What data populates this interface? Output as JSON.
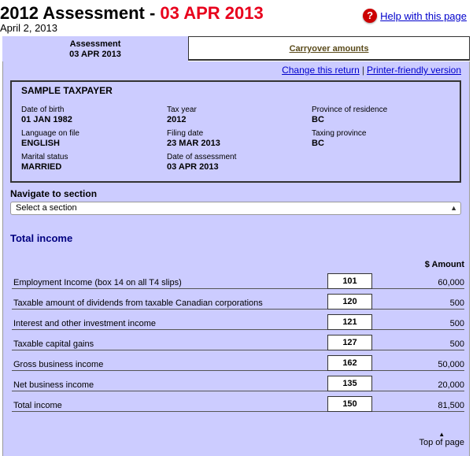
{
  "header": {
    "title_prefix": "2012 Assessment - ",
    "title_date": "03 APR 2013",
    "date": "April 2, 2013",
    "help_icon": "question-icon",
    "help_label": "Help with this page"
  },
  "tabs": {
    "active_line1": "Assessment",
    "active_line2": "03 APR 2013",
    "other": "Carryover amounts"
  },
  "links": {
    "change": "Change this return",
    "separator": "|",
    "printer": "Printer-friendly version"
  },
  "taxpayer": {
    "name": "SAMPLE TAXPAYER",
    "fields": [
      {
        "label": "Date of birth",
        "value": "01 JAN 1982"
      },
      {
        "label": "Tax year",
        "value": "2012"
      },
      {
        "label": "Province of residence",
        "value": "BC"
      },
      {
        "label": "Language on file",
        "value": "ENGLISH"
      },
      {
        "label": "Filing date",
        "value": "23 MAR 2013"
      },
      {
        "label": "Taxing province",
        "value": "BC"
      },
      {
        "label": "Marital status",
        "value": "MARRIED"
      },
      {
        "label": "Date of assessment",
        "value": "03 APR 2013"
      }
    ]
  },
  "navigate": {
    "label": "Navigate to section",
    "select_value": "Select a section"
  },
  "income": {
    "title": "Total income",
    "amount_header": "$ Amount",
    "rows": [
      {
        "label": "Employment Income (box 14 on all T4 slips)",
        "code": "101",
        "amount": "60,000"
      },
      {
        "label": "Taxable amount of dividends from taxable Canadian corporations",
        "code": "120",
        "amount": "500"
      },
      {
        "label": "Interest and other investment income",
        "code": "121",
        "amount": "500"
      },
      {
        "label": "Taxable capital gains",
        "code": "127",
        "amount": "500"
      },
      {
        "label": "Gross business income",
        "code": "162",
        "amount": "50,000"
      },
      {
        "label": "Net business income",
        "code": "135",
        "amount": "20,000"
      },
      {
        "label": "Total income",
        "code": "150",
        "amount": "81,500"
      }
    ]
  },
  "footer": {
    "top_link": "Top of page"
  }
}
